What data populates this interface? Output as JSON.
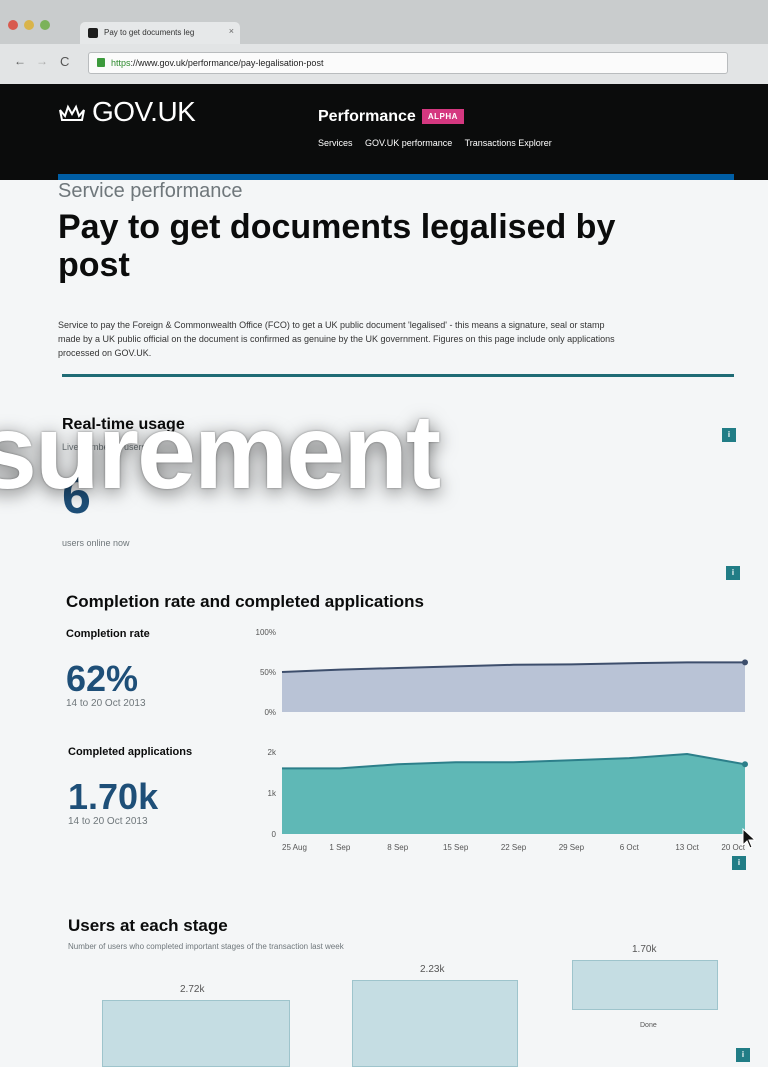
{
  "browser": {
    "tab_title": "Pay to get documents leg",
    "tab_close": "×",
    "url_scheme": "https",
    "url_rest": "://www.gov.uk/performance/pay-legalisation-post",
    "back": "←",
    "forward": "→",
    "reload": "C"
  },
  "header": {
    "logo_text": "GOV.UK",
    "product_title": "Performance",
    "badge": "ALPHA",
    "nav": [
      "Services",
      "GOV.UK performance",
      "Transactions Explorer"
    ]
  },
  "page": {
    "kicker": "Service performance",
    "title": "Pay to get documents legalised by post",
    "intro": "Service to pay the Foreign & Commonwealth Office (FCO) to get a UK public document 'legalised' - this means a signature, seal or stamp made by a UK public official on the document is confirmed as genuine by the UK government. Figures on this page include only applications processed on GOV.UK."
  },
  "realtime": {
    "heading": "Real-time usage",
    "sub": "Live number of users",
    "value": "6",
    "caption": "users online now"
  },
  "info_label": "i",
  "completion": {
    "heading": "Completion rate and completed applications",
    "rate_label": "Completion rate",
    "rate_value": "62%",
    "rate_date": "14 to 20 Oct 2013",
    "apps_label": "Completed applications",
    "apps_value": "1.70k",
    "apps_date": "14 to 20 Oct 2013",
    "tick_top": [
      "100%",
      "50%",
      "0%"
    ],
    "tick_bottom": [
      "2k",
      "1k",
      "0"
    ]
  },
  "chart_data": {
    "type": "area",
    "x": [
      "25 Aug",
      "1 Sep",
      "8 Sep",
      "15 Sep",
      "22 Sep",
      "29 Sep",
      "6 Oct",
      "13 Oct",
      "20 Oct"
    ],
    "series": [
      {
        "name": "Completion rate",
        "values": [
          50,
          53,
          55,
          57,
          59,
          59.5,
          61,
          62,
          62
        ],
        "unit": "%"
      },
      {
        "name": "Completed applications",
        "values": [
          1.6,
          1.6,
          1.7,
          1.75,
          1.75,
          1.8,
          1.85,
          1.95,
          1.7
        ],
        "unit": "k"
      }
    ],
    "ylim_top": [
      0,
      100
    ],
    "ylim_bottom": [
      0,
      2
    ],
    "colors": {
      "rate_fill": "#b9c3d6",
      "rate_line": "#3d4e6c",
      "apps_fill": "#5fb8b6",
      "apps_line": "#2c7f8a"
    }
  },
  "stages": {
    "heading": "Users at each stage",
    "sub": "Number of users who completed important stages of the transaction last week",
    "items": [
      {
        "value": "2.72k",
        "name": ""
      },
      {
        "value": "2.23k",
        "name": ""
      },
      {
        "value": "1.70k",
        "name": "Done"
      }
    ]
  },
  "overlay": {
    "word": "surement"
  }
}
